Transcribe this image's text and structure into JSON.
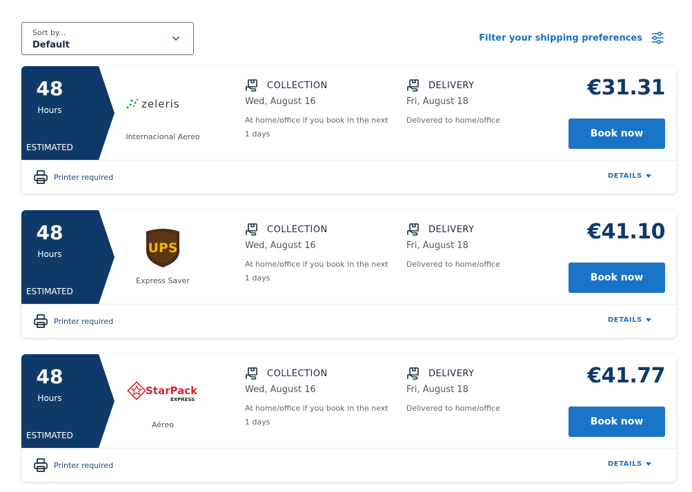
{
  "sort": {
    "label": "Sort by...",
    "value": "Default"
  },
  "filter": {
    "label": "Filter your shipping preferences",
    "icon": "sliders-icon"
  },
  "colors": {
    "navy": "#0f3a68",
    "accent_blue": "#1b73c7",
    "link_blue": "#1c6fc2"
  },
  "offers": [
    {
      "eta_value": "48",
      "eta_unit": "Hours",
      "eta_note": "ESTIMATED",
      "carrier_logo_text": "zeleris",
      "service": "Internacional Aereo",
      "collection": {
        "title": "COLLECTION",
        "date": "Wed, August 16",
        "note": "At home/office if you book in the next 1 days"
      },
      "delivery": {
        "title": "DELIVERY",
        "date": "Fri, August 18",
        "note": "Delivered to home/office"
      },
      "price": "€31.31",
      "book_label": "Book now",
      "printer_label": "Printer required",
      "details_label": "DETAILS"
    },
    {
      "eta_value": "48",
      "eta_unit": "Hours",
      "eta_note": "ESTIMATED",
      "carrier_logo_text": "UPS",
      "service": "Express Saver",
      "collection": {
        "title": "COLLECTION",
        "date": "Wed, August 16",
        "note": "At home/office if you book in the next 1 days"
      },
      "delivery": {
        "title": "DELIVERY",
        "date": "Fri, August 18",
        "note": "Delivered to home/office"
      },
      "price": "€41.10",
      "book_label": "Book now",
      "printer_label": "Printer required",
      "details_label": "DETAILS"
    },
    {
      "eta_value": "48",
      "eta_unit": "Hours",
      "eta_note": "ESTIMATED",
      "carrier_logo_text": "StarPack EXPRESS",
      "service": "Aéreo",
      "collection": {
        "title": "COLLECTION",
        "date": "Wed, August 16",
        "note": "At home/office if you book in the next 1 days"
      },
      "delivery": {
        "title": "DELIVERY",
        "date": "Fri, August 18",
        "note": "Delivered to home/office"
      },
      "price": "€41.77",
      "book_label": "Book now",
      "printer_label": "Printer required",
      "details_label": "DETAILS"
    }
  ]
}
